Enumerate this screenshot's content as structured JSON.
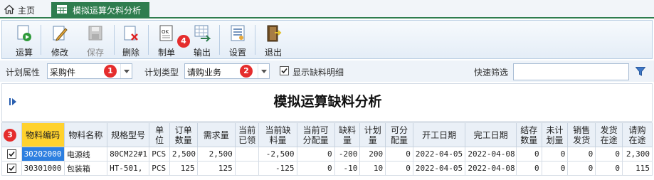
{
  "tabs": {
    "home_label": "主页",
    "active_label": "模拟运算欠料分析"
  },
  "toolbar": {
    "buttons": [
      {
        "label": "运算",
        "enabled": true
      },
      {
        "label": "修改",
        "enabled": true
      },
      {
        "label": "保存",
        "enabled": false
      },
      {
        "label": "删除",
        "enabled": true
      },
      {
        "label": "制单",
        "enabled": true
      },
      {
        "label": "输出",
        "enabled": true
      },
      {
        "label": "设置",
        "enabled": true
      },
      {
        "label": "退出",
        "enabled": true
      }
    ]
  },
  "badges": [
    "1",
    "2",
    "3",
    "4"
  ],
  "filters": {
    "plan_attr_label": "计划属性",
    "plan_attr_value": "采购件",
    "plan_type_label": "计划类型",
    "plan_type_value": "请购业务",
    "show_shortage_label": "显示缺料明细",
    "show_shortage_checked": true,
    "quick_filter_label": "快速筛选",
    "quick_filter_value": ""
  },
  "report": {
    "title": "模拟运算缺料分析"
  },
  "table": {
    "headers": [
      "",
      "物料编码",
      "物料名称",
      "规格型号",
      "单\n位",
      "订单\n数量",
      "需求量",
      "当前\n已领",
      "当前缺\n料量",
      "当前可\n分配量",
      "缺料\n量",
      "计划\n量",
      "可分\n配量",
      "开工日期",
      "完工日期",
      "结存\n数量",
      "未计\n划量",
      "销售\n发货",
      "发货\n在途",
      "请购\n在途"
    ],
    "rows": [
      {
        "checked": true,
        "code": "30202000",
        "name": "电源线",
        "spec": "80CM22#1",
        "unit": "PCS",
        "order_qty": "2,500",
        "demand": "2,500",
        "issued": "",
        "cur_short": "-2,500",
        "cur_alloc": "0",
        "short": "-200",
        "plan": "200",
        "alloc": "0",
        "start": "2022-04-05",
        "finish": "2022-04-08",
        "stock": "0",
        "unplanned": "0",
        "sales_ship": "0",
        "ship_transit": "0",
        "req_transit": "2,300"
      },
      {
        "checked": true,
        "code": "30301000",
        "name": "包装箱",
        "spec": "HT-501,",
        "unit": "PCS",
        "order_qty": "125",
        "demand": "125",
        "issued": "",
        "cur_short": "-125",
        "cur_alloc": "0",
        "short": "-10",
        "plan": "10",
        "alloc": "0",
        "start": "2022-04-05",
        "finish": "2022-04-08",
        "stock": "0",
        "unplanned": "0",
        "sales_ship": "0",
        "ship_transit": "0",
        "req_transit": "115"
      }
    ]
  }
}
